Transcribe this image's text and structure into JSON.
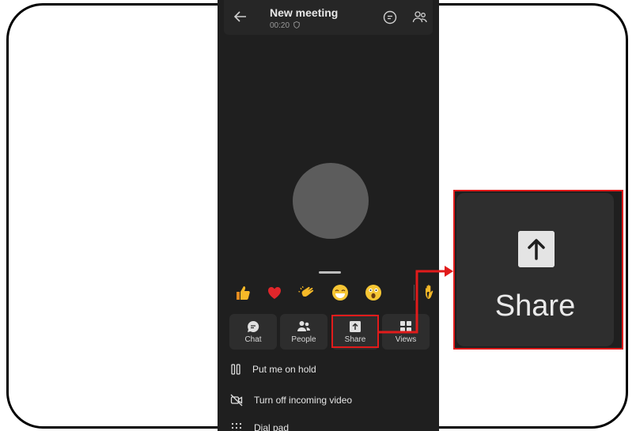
{
  "meeting": {
    "title": "New meeting",
    "timer": "00:20"
  },
  "reactions": [
    "thumbs-up",
    "heart",
    "clapping-hands",
    "laughing",
    "surprised",
    "raise-hand"
  ],
  "actions": {
    "chat": "Chat",
    "people": "People",
    "share": "Share",
    "views": "Views"
  },
  "menu": {
    "hold": "Put me on hold",
    "video": "Turn off incoming video",
    "dialpad": "Dial pad"
  },
  "zoom": {
    "label": "Share"
  },
  "colors": {
    "highlight": "#e11b1b",
    "background": "#1f1f1f"
  }
}
